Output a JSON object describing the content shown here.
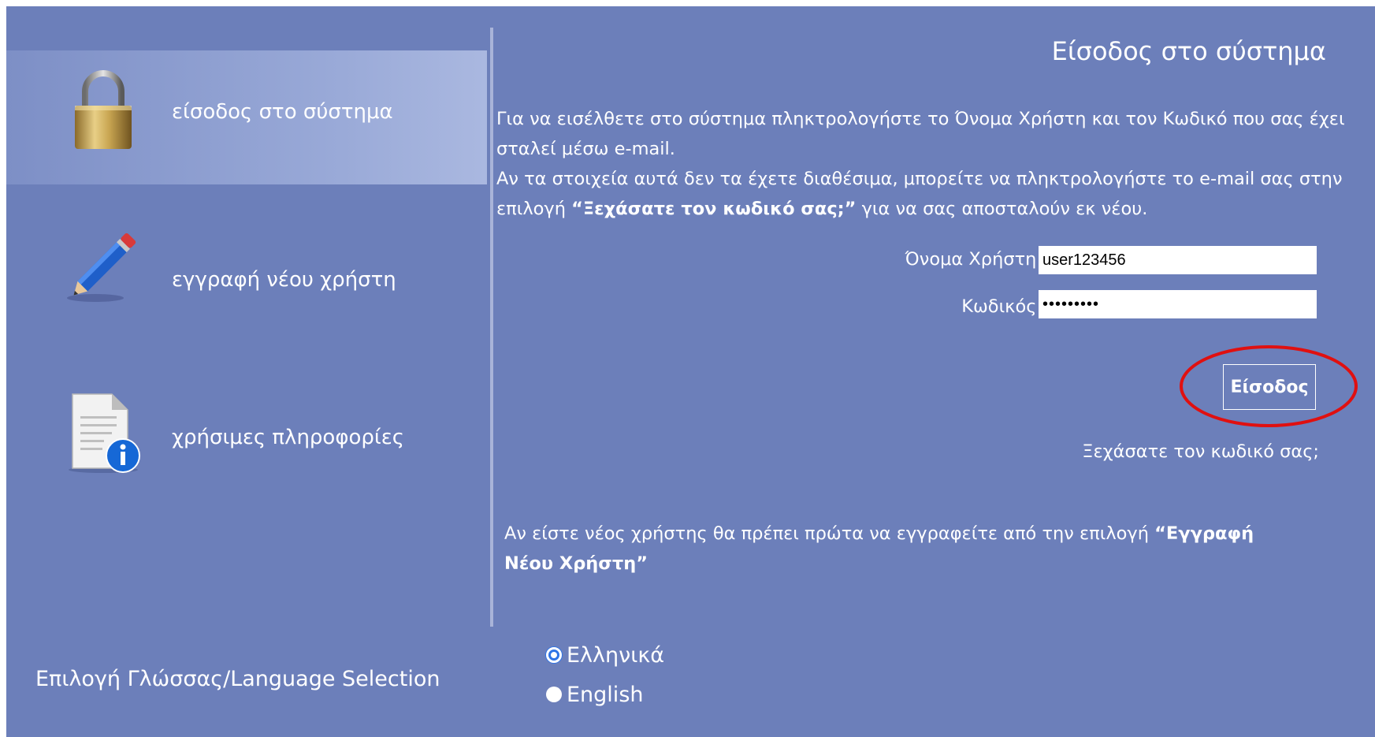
{
  "sidebar": {
    "items": [
      {
        "label": "είσοδος στο σύστημα",
        "icon": "padlock-icon",
        "active": true
      },
      {
        "label": "εγγραφή νέου χρήστη",
        "icon": "pencil-icon",
        "active": false
      },
      {
        "label": "χρήσιμες πληροφορίες",
        "icon": "info-document-icon",
        "active": false
      }
    ]
  },
  "main": {
    "title": "Είσοδος στο σύστημα",
    "intro": {
      "line1": "Για να εισέλθετε στο σύστημα πληκτρολογήστε το Όνομα Χρήστη και τον Κωδικό που σας έχει σταλεί μέσω e-mail.",
      "line2_before": "Αν τα στοιχεία αυτά δεν τα έχετε διαθέσιμα, μπορείτε να πληκτρολογήστε το e-mail σας στην επιλογή ",
      "line2_bold": "“Ξεχάσατε τον κωδικό σας;”",
      "line2_after": " για να σας αποσταλούν εκ νέου."
    },
    "form": {
      "username_label": "Όνομα Χρήστη:",
      "username_value": "user123456",
      "password_label": "Κωδικός:",
      "password_value": "•••••••••",
      "submit_label": "Είσοδος"
    },
    "forgot_link": "Ξεχάσατε τον κωδικό σας;",
    "new_user_note": {
      "before": "Αν είστε νέος χρήστης θα πρέπει πρώτα να εγγραφείτε από την επιλογή ",
      "bold": "“Εγγραφή Νέου Χρήστη”"
    }
  },
  "language": {
    "title": "Επιλογή Γλώσσας/Language Selection",
    "options": [
      {
        "label": "Ελληνικά",
        "selected": true
      },
      {
        "label": "English",
        "selected": false
      }
    ]
  },
  "colors": {
    "background": "#6c7fba",
    "highlight_ring": "#e01010",
    "radio_selected": "#2f74e6"
  }
}
